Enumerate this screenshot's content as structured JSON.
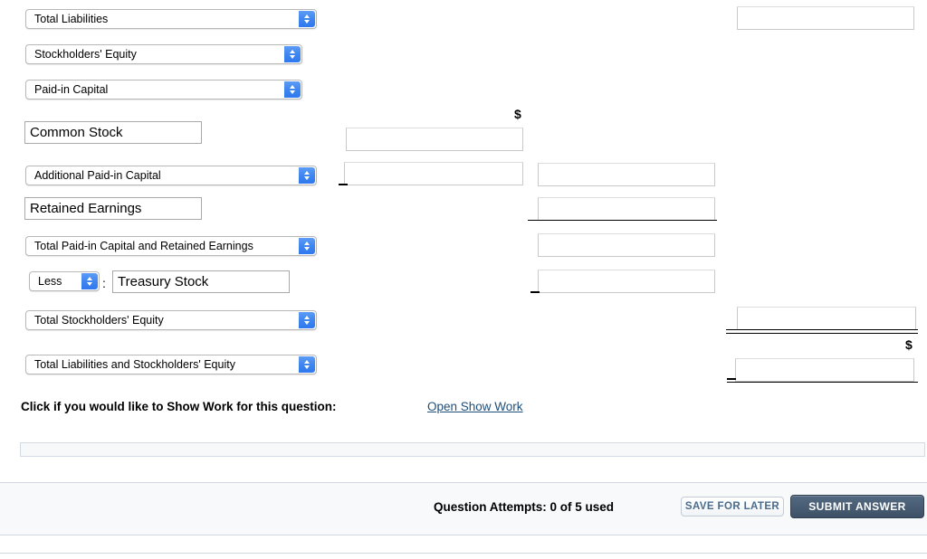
{
  "form": {
    "selects": [
      {
        "name": "total-liabilities",
        "value": "Total Liabilities"
      },
      {
        "name": "stockholders-equity",
        "value": "Stockholders' Equity"
      },
      {
        "name": "paid-in-capital",
        "value": "Paid-in Capital"
      },
      {
        "name": "additional-paid-in-capital",
        "value": "Additional Paid-in Capital"
      },
      {
        "name": "total-paid-in-and-retained",
        "value": "Total Paid-in Capital and Retained Earnings"
      },
      {
        "name": "less",
        "value": "Less"
      },
      {
        "name": "total-stockholders-equity",
        "value": "Total Stockholders' Equity"
      },
      {
        "name": "total-liab-and-equity",
        "value": "Total Liabilities and Stockholders' Equity"
      }
    ],
    "text_inputs": [
      {
        "name": "common-stock",
        "value": "Common Stock"
      },
      {
        "name": "retained-earnings",
        "value": "Retained Earnings"
      },
      {
        "name": "treasury-stock",
        "value": "Treasury Stock"
      }
    ],
    "amount_inputs": [
      {
        "name": "total-liabilities-amount",
        "value": ""
      },
      {
        "name": "common-stock-amount",
        "value": ""
      },
      {
        "name": "additional-paid-in-capital-amount",
        "value": ""
      },
      {
        "name": "paid-in-capital-subtotal",
        "value": ""
      },
      {
        "name": "retained-earnings-amount",
        "value": ""
      },
      {
        "name": "total-paid-in-and-retained-amount",
        "value": ""
      },
      {
        "name": "treasury-stock-amount",
        "value": ""
      },
      {
        "name": "total-stockholders-equity-amount",
        "value": ""
      },
      {
        "name": "total-liab-and-equity-amount",
        "value": ""
      }
    ],
    "separator": ":",
    "currency_symbol": "$"
  },
  "show_work": {
    "label": "Click if you would like to Show Work for this question:",
    "link": "Open Show Work"
  },
  "footer": {
    "attempts": "Question Attempts: 0 of 5 used",
    "save_label": "SAVE FOR LATER",
    "submit_label": "SUBMIT ANSWER"
  },
  "colors": {
    "link": "#1F4E79",
    "submit_bg": "#46596E",
    "select_arrow": "#3f86f0"
  }
}
